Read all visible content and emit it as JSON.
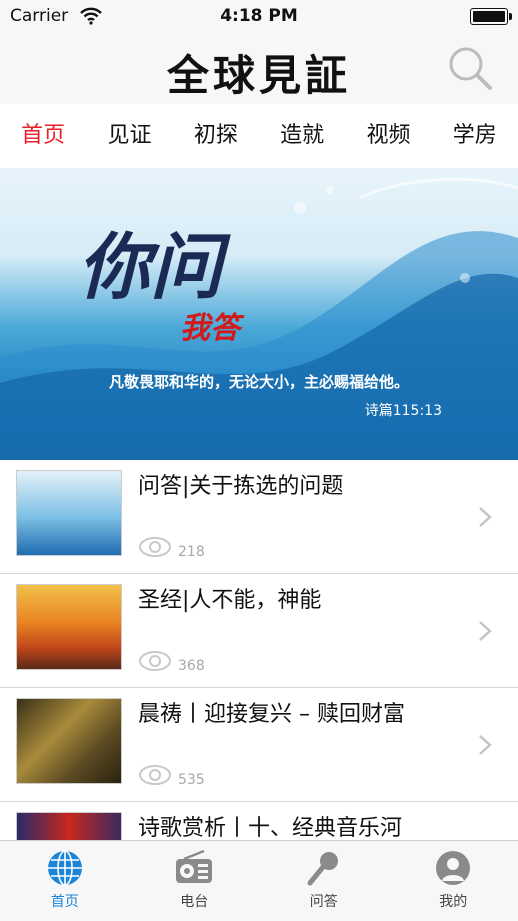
{
  "status_bar": {
    "carrier": "Carrier",
    "time": "4:18 PM"
  },
  "header": {
    "title": "全球見証"
  },
  "tabs": [
    {
      "label": "首页",
      "active": true
    },
    {
      "label": "见证",
      "active": false
    },
    {
      "label": "初探",
      "active": false
    },
    {
      "label": "造就",
      "active": false
    },
    {
      "label": "视频",
      "active": false
    },
    {
      "label": "学房",
      "active": false
    }
  ],
  "banner": {
    "headline": "你问",
    "subheadline": "我答",
    "verse": "凡敬畏耶和华的，无论大小，主必赐福给他。",
    "reference": "诗篇115:13"
  },
  "articles": [
    {
      "title": "问答|关于拣选的问题",
      "views": "218"
    },
    {
      "title": "圣经|人不能，神能",
      "views": "368"
    },
    {
      "title": "晨祷丨迎接复兴 – 赎回财富",
      "views": "535"
    },
    {
      "title": "诗歌赏析丨十、经典音乐河",
      "views": ""
    }
  ],
  "tabbar": [
    {
      "label": "首页",
      "icon": "globe-icon",
      "active": true
    },
    {
      "label": "电台",
      "icon": "radio-icon",
      "active": false
    },
    {
      "label": "问答",
      "icon": "microphone-icon",
      "active": false
    },
    {
      "label": "我的",
      "icon": "user-icon",
      "active": false
    }
  ],
  "colors": {
    "accent_red": "#e8202a",
    "accent_blue": "#1b86d8"
  }
}
